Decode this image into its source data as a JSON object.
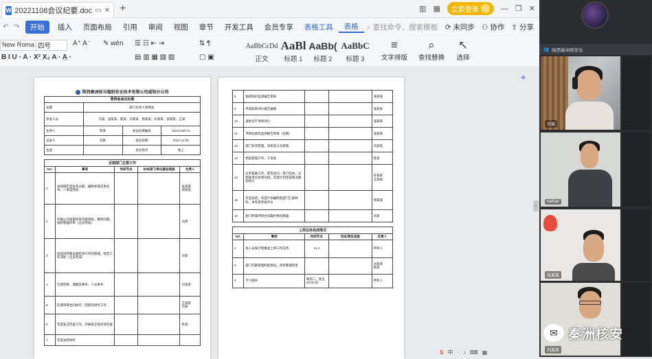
{
  "app": {
    "tab_title": "20221108会议纪要.doc",
    "login_label": "立即登录",
    "menu": [
      "开始",
      "插入",
      "页面布局",
      "引用",
      "审阅",
      "视图",
      "章节",
      "开发工具",
      "会员专享",
      "表格工具",
      "表格"
    ],
    "search_placeholder": "查找命令、搜索模板",
    "menu_right": [
      "未同步",
      "协作",
      "分享"
    ],
    "font_name": "New Roma",
    "font_size": "四号",
    "styles": [
      {
        "preview": "AaBbCcDd",
        "label": "正文"
      },
      {
        "preview": "AaBl",
        "label": "标题 1"
      },
      {
        "preview": "AaBb(",
        "label": "标题 2"
      },
      {
        "preview": "AaBbC",
        "label": "标题 3"
      }
    ],
    "tools": [
      {
        "icon": "≡",
        "label": "文字排版"
      },
      {
        "icon": "⌕",
        "label": "查找替换"
      },
      {
        "icon": "↖",
        "label": "选择"
      }
    ]
  },
  "page1": {
    "company": "陕西秦洲核与辐射安全技术有限公司咸阳分公司",
    "subtitle": "周例会会议纪要",
    "info": [
      {
        "k": "主题",
        "v": "部门负责人周例会"
      },
      {
        "k": "参会人员",
        "v": "刘某、张某某、陈某、刘某某、杨某某、孙某某、郭某某、王某"
      },
      {
        "k": "主持人",
        "v": "陈某",
        "k2": "会议纪要编号",
        "v2": "20221108-01"
      },
      {
        "k": "记录人",
        "v": "刘某",
        "k2": "会议日期",
        "v2": "2022-11-08"
      },
      {
        "k": "主送",
        "v": "",
        "k2": "会议地点",
        "v2": "线上"
      }
    ],
    "section_title": "近期部门主要工作",
    "headers": [
      "NO.",
      "事项",
      "时间节点",
      "对本部门/单位建设措施",
      "负责人"
    ],
    "rows": [
      {
        "no": "1",
        "item": "总经理年度任务分解，编制并落实责任书，一季度完成",
        "person": "张某某\n郭某某"
      },
      {
        "no": "2",
        "item": "开展公司质量体系内部审核，整改问题，组织管理评审（全员完成）",
        "person": "刘某"
      },
      {
        "no": "3",
        "item": "加强对所属设备检测工作的管理，规范工作流程（全员完成）",
        "person": "刘某"
      },
      {
        "no": "4",
        "item": "在建项目、课题及事务、人员事务",
        "person": "刘某某"
      },
      {
        "no": "5",
        "item": "在建项目合同执行、回款及财务工作",
        "person": "王某某\n刘某"
      },
      {
        "no": "6",
        "item": "年度安全检查工作，开展安全培训及检查",
        "person": "陈某"
      },
      {
        "no": "7",
        "item": "年度总结材料",
        "person": ""
      }
    ]
  },
  "page2": {
    "rows_top": [
      {
        "no": "8",
        "item": "辐射防护监测报告审核",
        "person": "张某某"
      },
      {
        "no": "9",
        "item": "环境影响评价报告编制",
        "person": "张某某"
      },
      {
        "no": "10",
        "item": "放射诊疗项目评价",
        "person": "张某某"
      },
      {
        "no": "11",
        "item": "项目验收及监测报告审核（延期）",
        "person": "张某某"
      },
      {
        "no": "12",
        "item": "部门日常管理，资质及人员管理",
        "person": "刘某某"
      },
      {
        "no": "13",
        "item": "档案管理工作，工资表",
        "person": "陈某"
      },
      {
        "no": "14",
        "item": "业务拓展工作，新签合同，客户回访，与相关单位协调对接，年度计划完成情况跟踪统计",
        "person": "孙某某\n王某某"
      },
      {
        "no": "15",
        "item": "年度总结，年度计划编制及部门汇报材料，本年度考核评价",
        "person": "郭某某"
      },
      {
        "no": "16",
        "item": "部门所属项目合同履约情况梳理",
        "person": "刘某"
      }
    ],
    "section_title": "上周任务完成情况",
    "headers": [
      "NO.",
      "事项",
      "时间节点",
      "完成/预见进度",
      "负责人"
    ],
    "rows_bottom": [
      {
        "no": "1",
        "item": "各人员按计划推进上周工作任务",
        "time": "11.4",
        "progress": "",
        "person": "所有人"
      },
      {
        "no": "2",
        "item": "部门内部管理制度建设，资料整理完善",
        "time": "",
        "progress": "",
        "person": "刘某某\n陈某"
      },
      {
        "no": "3",
        "item": "学习培训",
        "time": "每周二、周五 15:00 前",
        "progress": "",
        "person": "所有人"
      }
    ]
  },
  "meeting": {
    "room_label": "陕西秦洲核安全",
    "participants": [
      "刘某",
      "nathan",
      "张某某",
      "刘某某"
    ],
    "watermark": "秦洲核安"
  }
}
